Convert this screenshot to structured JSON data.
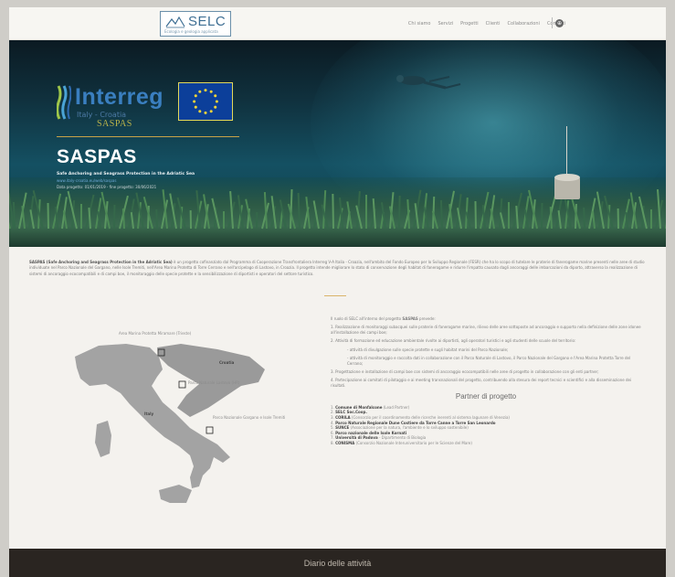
{
  "header": {
    "logo_text": "SELC",
    "logo_sub": "Ecologia e geologia applicata",
    "nav": [
      "Chi siamo",
      "Servizi",
      "Progetti",
      "Clienti",
      "Collaborazioni",
      "Contatti"
    ],
    "icon": "globe-icon"
  },
  "hero": {
    "interreg_title": "Interreg",
    "interreg_sub": "Italy - Croatia",
    "interreg_project": "SASPAS",
    "title": "SASPAS",
    "subtitle": "Safe Anchoring and Seagrass Protection in the Adriatic Sea",
    "link": "www.italy-croatia.eu/web/saspas",
    "dates": "Data progetto: 01/01/2019 - fine progetto: 30/06/2021"
  },
  "intro": {
    "lead": "SASPAS (Safe Anchoring and Seagrass Protection in the Adriatic Sea)",
    "text": " è un progetto cofinanziato dal Programma di Cooperazione Transfrontaliera Interreg V-A Italia - Croazia, nell'ambito del Fondo Europeo per lo Sviluppo Regionale (FESR) che ha lo scopo di tutelare le praterie di fanerogame marine presenti nelle aree di studio individuate nel Parco Nazionale del Gargano, nelle Isole Tremiti, nell'Area Marina Protetta di Torre Cerrano e nell'arcipelago di Lastovo, in Croazia. Il progetto intende migliorare lo stato di conservazione degli habitat di fanerogame e ridurre l'impatto causato dagli ancoraggi delle imbarcazioni da diporto, attraverso la realizzazione di sistemi di ancoraggio ecocompatibili e di campi boe, il monitoraggio delle specie protette e la sensibilizzazione di diportisti e operatori del settore turistico."
  },
  "map": {
    "labels": [
      {
        "text": "Area Marina Protetta Miramare (Trieste)",
        "cls": ""
      },
      {
        "text": "Croatia",
        "cls": "dark"
      },
      {
        "text": "Parco Naturale Lastovo (HR)",
        "cls": ""
      },
      {
        "text": "Italy",
        "cls": "dark"
      },
      {
        "text": "Parco Nazionale Gargano e Isole Tremiti",
        "cls": ""
      }
    ]
  },
  "right": {
    "intro_pre": "Il ruolo di SELC all'interno del progetto ",
    "intro_project": "SASPAS",
    "intro_post": " prevede:",
    "items": [
      "1. Realizzazione di monitoraggi subacquei sulle praterie di fanerogame marine, rilievo delle aree sottoposte ad ancoraggio e supporto nella definizione delle zone idonee all'installazione dei campi boe;",
      "2. Attività di formazione ed educazione ambientale rivolte ai diportisti, agli operatori turistici e agli studenti delle scuole del territorio:",
      "- attività di divulgazione sulle specie protette e sugli habitat marini del Parco Nazionale;",
      "- attività di monitoraggio e raccolta dati in collaborazione con il Parco Naturale di Lastovo, il Parco Nazionale del Gargano e l'Area Marina Protetta Torre del Cerrano;",
      "3. Progettazione e installazione di campi boe con sistemi di ancoraggio ecocompatibili nelle aree di progetto in collaborazione con gli enti partner;",
      "4. Partecipazione ai comitati di pilotaggio e ai meeting transnazionali del progetto, contribuendo alla stesura dei report tecnici e scientifici e alla disseminazione dei risultati."
    ],
    "partners_title": "Partner di progetto",
    "partners": [
      {
        "name": "Comune di Monfalcone",
        "note": " (Lead Partner)"
      },
      {
        "name": "SELC Soc.Coop.",
        "note": ""
      },
      {
        "name": "CORILA",
        "note": " (Consorzio per il coordinamento delle ricerche inerenti al sistema lagunare di Venezia)"
      },
      {
        "name": "Parco Naturale Regionale Dune Costiere da Torre Canne a Torre San Leonardo",
        "note": ""
      },
      {
        "name": "SUNCE",
        "note": " (Associazione per la natura, l'ambiente e lo sviluppo sostenibile)"
      },
      {
        "name": "Parco nazionale delle Isole Kornati",
        "note": ""
      },
      {
        "name": "Università di Padova",
        "note": " - Dipartimento di Biologia"
      },
      {
        "name": "CONISMA",
        "note": " (Consorzio Nazionale Interuniversitario per le Scienze del Mare)"
      }
    ]
  },
  "footer": {
    "text": "Diario delle attività"
  },
  "colors": {
    "accent": "#3d6e93",
    "gold": "#c9a347",
    "footer": "#2a2521"
  }
}
